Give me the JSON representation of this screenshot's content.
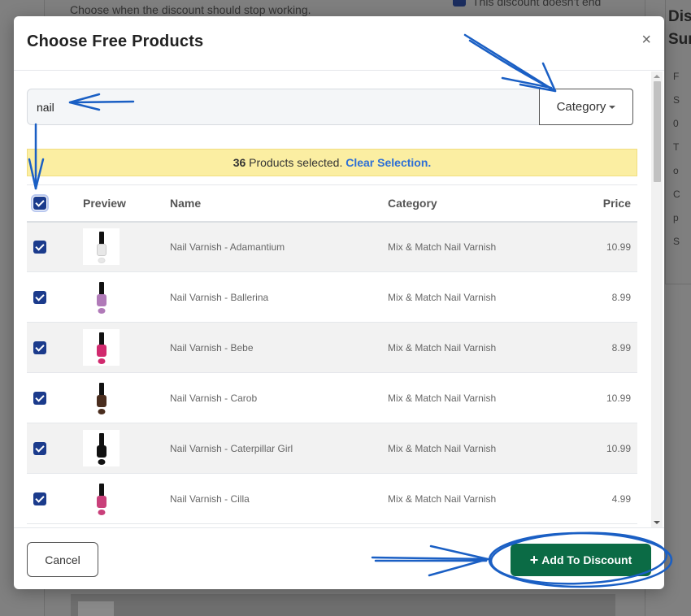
{
  "background": {
    "description_text": "Choose when the discount should stop working.",
    "checkbox_label": "This discount doesn't end",
    "right_panel_title": "Discount Summary",
    "right_panel_bullets": [
      "F",
      "S",
      "0",
      "T",
      "o",
      "C",
      "p",
      "S"
    ]
  },
  "modal": {
    "title": "Choose Free Products",
    "close_symbol": "×"
  },
  "search": {
    "value": "nail",
    "category_label": "Category"
  },
  "selection": {
    "count": "36",
    "text": " Products selected. ",
    "clear_label": "Clear Selection."
  },
  "table": {
    "headers": {
      "preview": "Preview",
      "name": "Name",
      "category": "Category",
      "price": "Price"
    },
    "rows": [
      {
        "name": "Nail Varnish - Adamantium",
        "category": "Mix & Match Nail Varnish",
        "price": "10.99",
        "color": "#e8e8e8"
      },
      {
        "name": "Nail Varnish - Ballerina",
        "category": "Mix & Match Nail Varnish",
        "price": "8.99",
        "color": "#b07ab8"
      },
      {
        "name": "Nail Varnish - Bebe",
        "category": "Mix & Match Nail Varnish",
        "price": "8.99",
        "color": "#d12a6e"
      },
      {
        "name": "Nail Varnish - Carob",
        "category": "Mix & Match Nail Varnish",
        "price": "10.99",
        "color": "#4a2d1e"
      },
      {
        "name": "Nail Varnish - Caterpillar Girl",
        "category": "Mix & Match Nail Varnish",
        "price": "10.99",
        "color": "#111111"
      },
      {
        "name": "Nail Varnish - Cilla",
        "category": "Mix & Match Nail Varnish",
        "price": "4.99",
        "color": "#c9407a"
      }
    ]
  },
  "footer": {
    "cancel_label": "Cancel",
    "add_label": "Add To Discount"
  },
  "colors": {
    "primary": "#0b6b45",
    "checkbox": "#1b3b8c",
    "link": "#2d6fd6",
    "banner": "#fbeea2",
    "annotation": "#1a5fc4"
  }
}
